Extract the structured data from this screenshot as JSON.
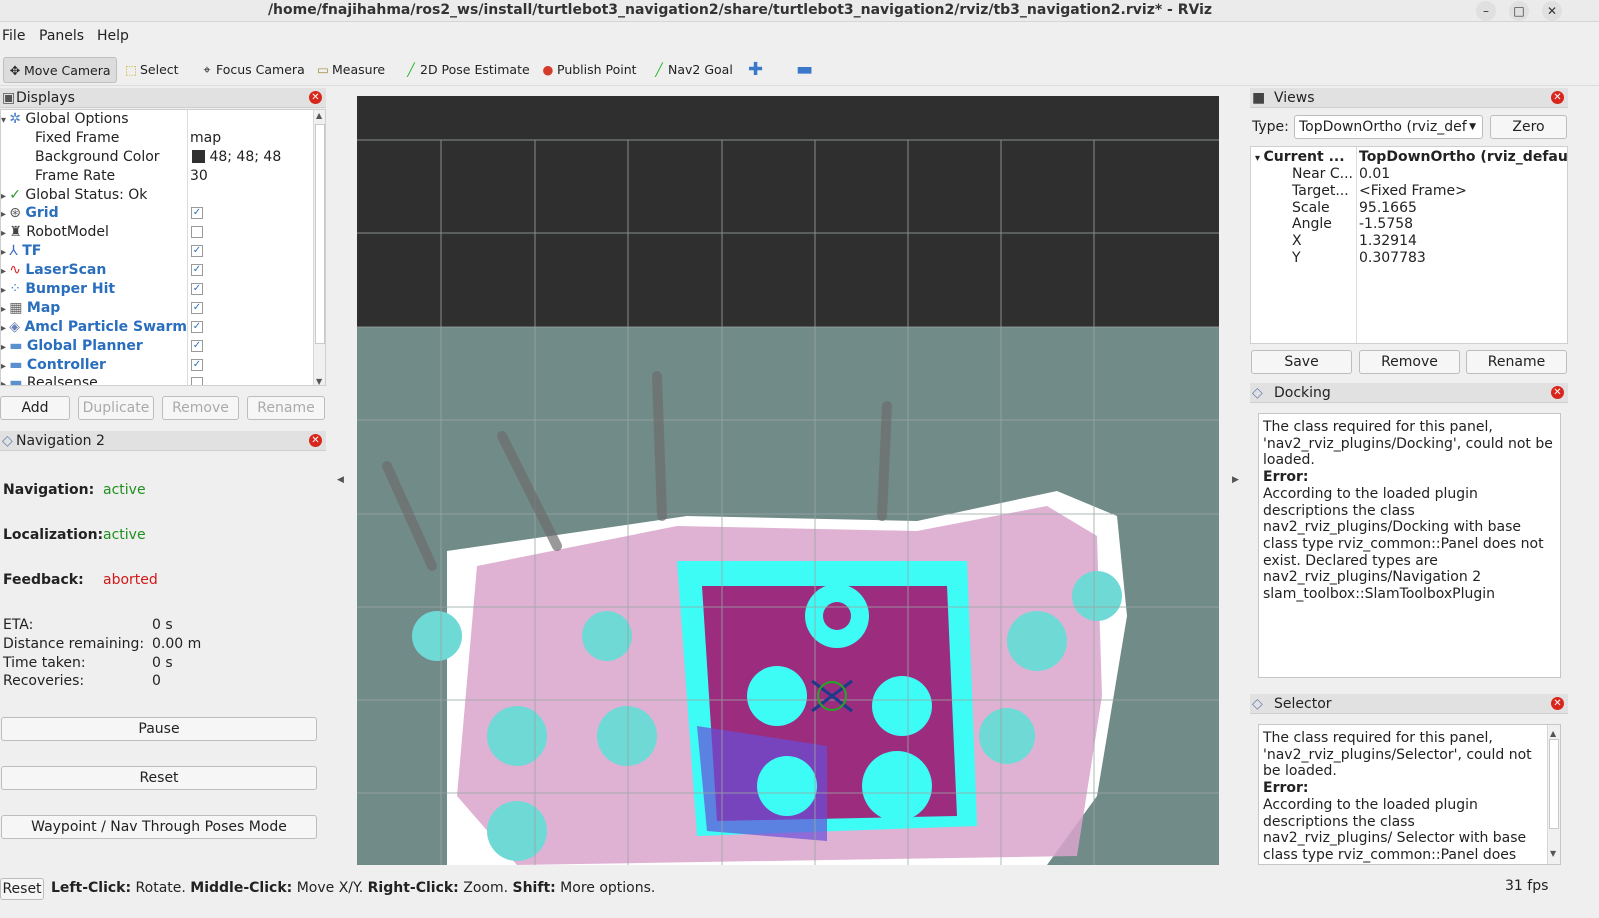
{
  "window": {
    "title": "/home/fnajihahma/ros2_ws/install/turtlebot3_navigation2/share/turtlebot3_navigation2/rviz/tb3_navigation2.rviz* - RViz"
  },
  "menu": [
    "File",
    "Panels",
    "Help"
  ],
  "toolbar": {
    "move_camera": "Move Camera",
    "select": "Select",
    "focus_camera": "Focus Camera",
    "measure": "Measure",
    "pose_estimate": "2D Pose Estimate",
    "publish_point": "Publish Point",
    "nav2_goal": "Nav2 Goal"
  },
  "displays": {
    "title": "Displays",
    "global_options": "Global Options",
    "fixed_frame": {
      "label": "Fixed Frame",
      "value": "map"
    },
    "background_color": {
      "label": "Background Color",
      "value": "48; 48; 48"
    },
    "frame_rate": {
      "label": "Frame Rate",
      "value": "30"
    },
    "global_status": "Global Status: Ok",
    "items": [
      {
        "label": "Grid",
        "checked": true
      },
      {
        "label": "RobotModel",
        "checked": false
      },
      {
        "label": "TF",
        "checked": true
      },
      {
        "label": "LaserScan",
        "checked": true
      },
      {
        "label": "Bumper Hit",
        "checked": true
      },
      {
        "label": "Map",
        "checked": true
      },
      {
        "label": "Amcl Particle Swarm",
        "checked": true
      },
      {
        "label": "Global Planner",
        "checked": true
      },
      {
        "label": "Controller",
        "checked": true
      },
      {
        "label": "Realsense",
        "checked": false
      }
    ],
    "buttons": {
      "add": "Add",
      "duplicate": "Duplicate",
      "remove": "Remove",
      "rename": "Rename"
    }
  },
  "navigation2": {
    "title": "Navigation 2",
    "navigation": {
      "label": "Navigation:",
      "value": "active"
    },
    "localization": {
      "label": "Localization:",
      "value": "active"
    },
    "feedback": {
      "label": "Feedback:",
      "value": "aborted"
    },
    "eta": {
      "label": "ETA:",
      "value": "0 s"
    },
    "distance": {
      "label": "Distance remaining:",
      "value": "0.00 m"
    },
    "time_taken": {
      "label": "Time taken:",
      "value": "0 s"
    },
    "recoveries": {
      "label": "Recoveries:",
      "value": "0"
    },
    "buttons": {
      "pause": "Pause",
      "reset": "Reset",
      "waypoint": "Waypoint / Nav Through Poses Mode"
    }
  },
  "views": {
    "title": "Views",
    "type_label": "Type:",
    "type_value": "TopDownOrtho (rviz_def",
    "zero": "Zero",
    "current_label": "Current ...",
    "current_value": "TopDownOrtho (rviz_defau...",
    "props": [
      {
        "label": "Near C...",
        "value": "0.01"
      },
      {
        "label": "Target...",
        "value": "<Fixed Frame>"
      },
      {
        "label": "Scale",
        "value": "95.1665"
      },
      {
        "label": "Angle",
        "value": "-1.5758"
      },
      {
        "label": "X",
        "value": "1.32914"
      },
      {
        "label": "Y",
        "value": "0.307783"
      }
    ],
    "buttons": {
      "save": "Save",
      "remove": "Remove",
      "rename": "Rename"
    }
  },
  "docking": {
    "title": "Docking",
    "line1": "The class required for this panel, 'nav2_rviz_plugins/Docking', could not be loaded.",
    "error_label": "Error:",
    "line2": "According to the loaded plugin descriptions the class nav2_rviz_plugins/Docking with base class type rviz_common::Panel does not exist. Declared types are nav2_rviz_plugins/Navigation 2 slam_toolbox::SlamToolboxPlugin"
  },
  "selector": {
    "title": "Selector",
    "line1": "The class required for this panel, 'nav2_rviz_plugins/Selector', could not be loaded.",
    "error_label": "Error:",
    "line2": "According to the loaded plugin descriptions the class nav2_rviz_plugins/ Selector with base class type rviz_common::Panel does not exist."
  },
  "status": {
    "reset": "Reset",
    "left": "Left-Click:",
    "left_t": " Rotate. ",
    "middle": "Middle-Click:",
    "middle_t": " Move X/Y. ",
    "right": "Right-Click:",
    "right_t": " Zoom. ",
    "shift": "Shift:",
    "shift_t": " More options.",
    "fps": "31 fps"
  }
}
